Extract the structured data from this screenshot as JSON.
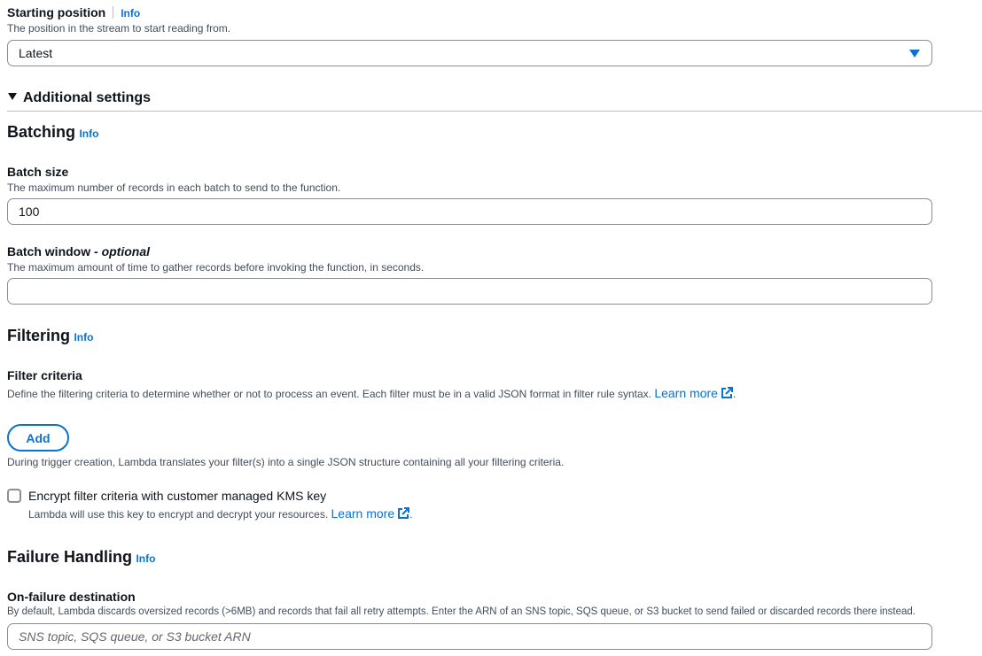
{
  "starting_position": {
    "label": "Starting position",
    "info": "Info",
    "description": "The position in the stream to start reading from.",
    "selected_value": "Latest"
  },
  "additional_settings": {
    "title": "Additional settings",
    "expanded": true
  },
  "batching": {
    "heading": "Batching",
    "info": "Info",
    "batch_size": {
      "label": "Batch size",
      "description": "The maximum number of records in each batch to send to the function.",
      "value": "100"
    },
    "batch_window": {
      "label": "Batch window - ",
      "optional": "optional",
      "description": "The maximum amount of time to gather records before invoking the function, in seconds.",
      "value": ""
    }
  },
  "filtering": {
    "heading": "Filtering",
    "info": "Info",
    "filter_criteria": {
      "label": "Filter criteria",
      "description": "Define the filtering criteria to determine whether or not to process an event. Each filter must be in a valid JSON format in filter rule syntax.",
      "learn_more": "Learn more",
      "trailing": "."
    },
    "add_button": "Add",
    "note": "During trigger creation, Lambda translates your filter(s) into a single JSON structure containing all your filtering criteria.",
    "encrypt": {
      "label": "Encrypt filter criteria with customer managed KMS key",
      "description": "Lambda will use this key to encrypt and decrypt your resources.",
      "learn_more": "Learn more",
      "trailing": ".",
      "checked": false
    }
  },
  "failure_handling": {
    "heading": "Failure Handling",
    "info": "Info",
    "destination": {
      "label": "On-failure destination",
      "description": "By default, Lambda discards oversized records (>6MB) and records that fail all retry attempts. Enter the ARN of an SNS topic, SQS queue, or S3 bucket to send failed or discarded records there instead.",
      "placeholder": "SNS topic, SQS queue, or S3 bucket ARN",
      "value": ""
    }
  },
  "colors": {
    "link": "#0972d3",
    "text": "#0f141a",
    "description": "#414d5c",
    "border": "#8c8c94"
  }
}
